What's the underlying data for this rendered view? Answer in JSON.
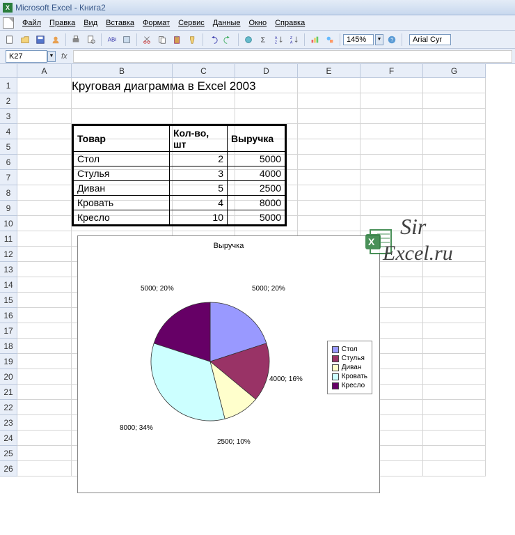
{
  "titlebar": {
    "app": "Microsoft Excel",
    "doc": "Книга2"
  },
  "menu": [
    "Файл",
    "Правка",
    "Вид",
    "Вставка",
    "Формат",
    "Сервис",
    "Данные",
    "Окно",
    "Справка"
  ],
  "toolbar": {
    "zoom": "145%",
    "font": "Arial Cyr"
  },
  "formula": {
    "namebox": "K27",
    "fx": "fx"
  },
  "columns": [
    "A",
    "B",
    "C",
    "D",
    "E",
    "F",
    "G"
  ],
  "rows": [
    "1",
    "2",
    "3",
    "4",
    "5",
    "6",
    "7",
    "8",
    "9",
    "10",
    "11",
    "12",
    "13",
    "14",
    "15",
    "16",
    "17",
    "18",
    "19",
    "20",
    "21",
    "22",
    "23",
    "24",
    "25",
    "26"
  ],
  "title_cell": "Круговая диаграмма в Excel 2003",
  "table": {
    "headers": [
      "Товар",
      "Кол-во, шт",
      "Выручка"
    ],
    "rows": [
      [
        "Стол",
        2,
        5000
      ],
      [
        "Стулья",
        3,
        4000
      ],
      [
        "Диван",
        5,
        2500
      ],
      [
        "Кровать",
        4,
        8000
      ],
      [
        "Кресло",
        10,
        5000
      ]
    ]
  },
  "chart_data": {
    "type": "pie",
    "title": "Выручка",
    "series": [
      {
        "name": "Стол",
        "value": 5000,
        "pct": 20,
        "color": "#9999ff"
      },
      {
        "name": "Стулья",
        "value": 4000,
        "pct": 16,
        "color": "#993366"
      },
      {
        "name": "Диван",
        "value": 2500,
        "pct": 10,
        "color": "#ffffcc"
      },
      {
        "name": "Кровать",
        "value": 8000,
        "pct": 34,
        "color": "#ccffff"
      },
      {
        "name": "Кресло",
        "value": 5000,
        "pct": 20,
        "color": "#660066"
      }
    ],
    "data_labels": [
      "5000; 20%",
      "4000; 16%",
      "2500; 10%",
      "8000; 34%",
      "5000; 20%"
    ],
    "legend": [
      "Стол",
      "Стулья",
      "Диван",
      "Кровать",
      "Кресло"
    ]
  },
  "watermark": {
    "sir": "Sir",
    "domain": "Excel.ru"
  }
}
